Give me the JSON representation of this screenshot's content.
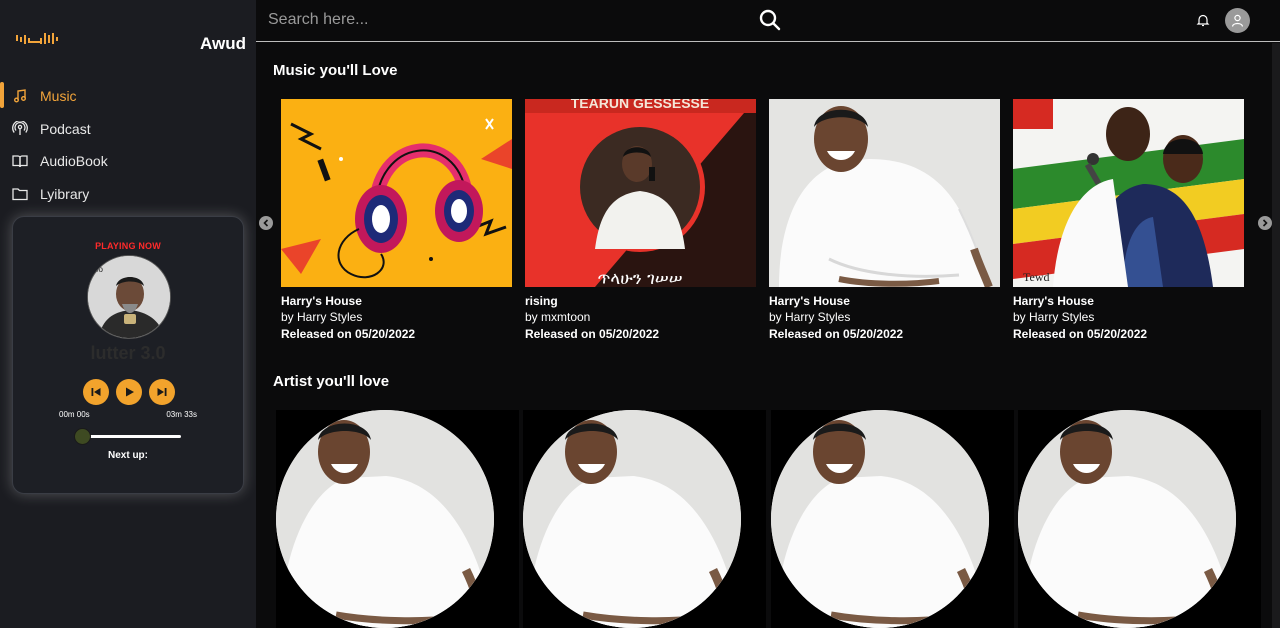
{
  "app": {
    "name": "Awud"
  },
  "sidebar": {
    "items": [
      {
        "label": "Music",
        "icon": "music-note-icon",
        "active": true
      },
      {
        "label": "Podcast",
        "icon": "podcast-icon",
        "active": false
      },
      {
        "label": "AudioBook",
        "icon": "book-icon",
        "active": false
      },
      {
        "label": "Lyibrary",
        "icon": "folder-icon",
        "active": false
      }
    ]
  },
  "player": {
    "status": "PLAYING NOW",
    "title": "lutter 3.0",
    "elapsed": "00m 00s",
    "duration": "03m 33s",
    "progress": 0,
    "next_up": "Next up:"
  },
  "search": {
    "placeholder": "Search here..."
  },
  "sections": {
    "music_title": "Music you'll Love",
    "artist_title": "Artist you'll love"
  },
  "music_cards": [
    {
      "title": "Harry's House",
      "artist": "by Harry Styles",
      "release": "Released on 05/20/2022"
    },
    {
      "title": "rising",
      "artist": "by mxmtoon",
      "release": "Released on 05/20/2022",
      "cover_text_top": "TEARUN GESSESSE",
      "cover_text_bottom": "ጥላሁን ገሠሠ"
    },
    {
      "title": "Harry's House",
      "artist": "by Harry Styles",
      "release": "Released on 05/20/2022"
    },
    {
      "title": "Harry's House",
      "artist": "by Harry Styles",
      "release": "Released on 05/20/2022"
    }
  ],
  "colors": {
    "accent": "#f2a43a",
    "playing_now": "#ff2a2a",
    "sidebar_bg": "#1b1c21",
    "main_bg": "#0b0b0c"
  }
}
